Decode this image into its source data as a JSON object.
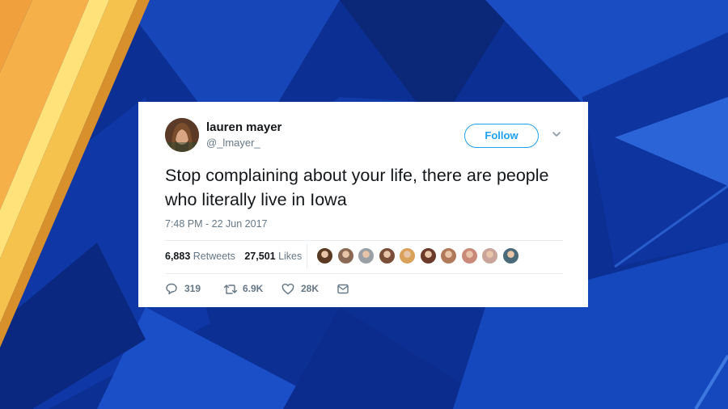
{
  "tweet": {
    "author_name": "lauren mayer",
    "author_handle": "@_lmayer_",
    "follow_label": "Follow",
    "text": "Stop complaining about your life, there are people who literally live in Iowa",
    "timestamp": "7:48 PM - 22 Jun 2017",
    "retweets_count": "6,883",
    "retweets_label": "Retweets",
    "likes_count": "27,501",
    "likes_label": "Likes",
    "actions": {
      "reply_count": "319",
      "retweet_count": "6.9K",
      "like_count": "28K"
    },
    "liker_avatar_colors": [
      "#5a3a22",
      "#8a6a55",
      "#9aa0a6",
      "#7a4e38",
      "#d9a15a",
      "#6b3a2a",
      "#b07a5a",
      "#c98a7a",
      "#c9a49a",
      "#4a6a7a"
    ]
  },
  "colors": {
    "twitter_blue": "#1da1f2",
    "background_blue": "#0a2a8a",
    "stripe_orange": "#f4a23a",
    "stripe_yellow": "#f8d64a"
  }
}
